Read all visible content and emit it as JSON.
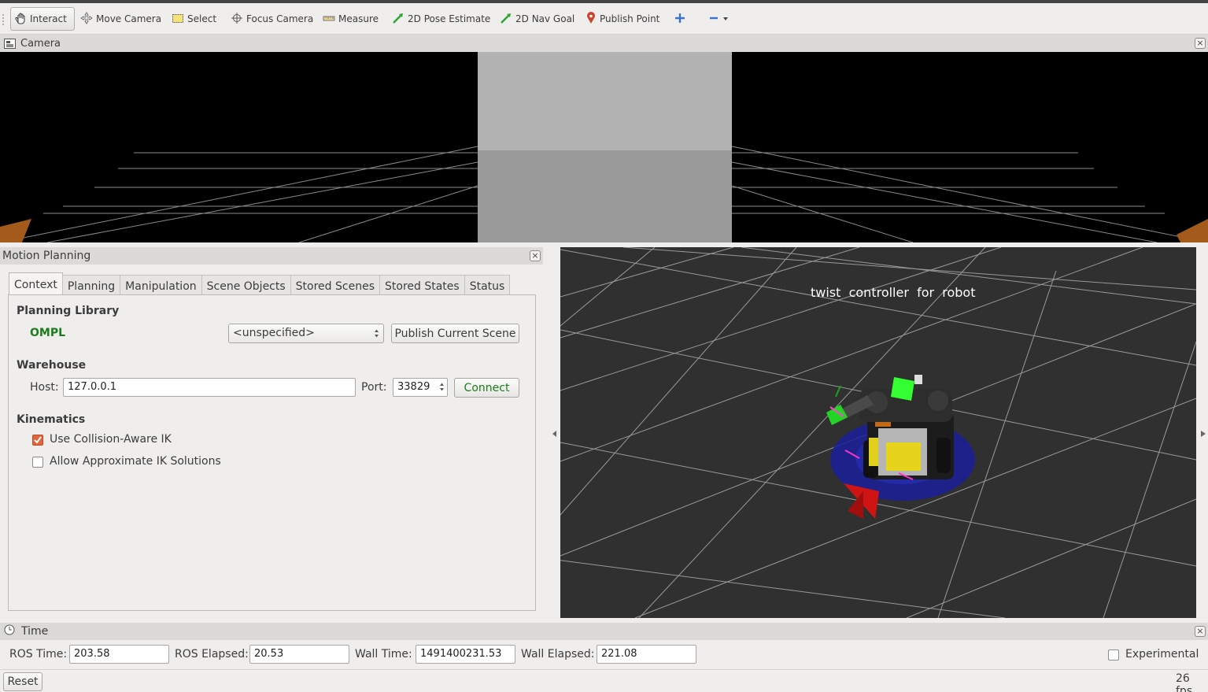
{
  "toolbar": {
    "tools": [
      {
        "label": "Interact",
        "icon": "hand-pointer-icon"
      },
      {
        "label": "Move Camera",
        "icon": "move-arrows-icon"
      },
      {
        "label": "Select",
        "icon": "selection-box-icon"
      },
      {
        "label": "Focus Camera",
        "icon": "crosshair-icon"
      },
      {
        "label": "Measure",
        "icon": "ruler-icon"
      },
      {
        "label": "2D Pose Estimate",
        "icon": "green-arrow-icon"
      },
      {
        "label": "2D Nav Goal",
        "icon": "green-arrow-icon"
      },
      {
        "label": "Publish Point",
        "icon": "map-pin-icon"
      }
    ],
    "add_icon": "plus-icon",
    "remove_icon": "minus-icon"
  },
  "camera_panel": {
    "title": "Camera"
  },
  "motion_planning": {
    "title": "Motion Planning",
    "tabs": [
      "Context",
      "Planning",
      "Manipulation",
      "Scene Objects",
      "Stored Scenes",
      "Stored States",
      "Status"
    ],
    "active_tab": "Context",
    "planning_library": {
      "heading": "Planning Library",
      "name": "OMPL",
      "planner_value": "<unspecified>",
      "publish_button": "Publish Current Scene"
    },
    "warehouse": {
      "heading": "Warehouse",
      "host_label": "Host:",
      "host_value": "127.0.0.1",
      "port_label": "Port:",
      "port_value": "33829",
      "connect_button": "Connect"
    },
    "kinematics": {
      "heading": "Kinematics",
      "collision_aware_label": "Use Collision-Aware IK",
      "collision_aware_checked": true,
      "approx_label": "Allow Approximate IK Solutions",
      "approx_checked": false
    }
  },
  "viewport": {
    "overlay_text": "twist  controller  for  robot"
  },
  "time_panel": {
    "title": "Time",
    "ros_time_label": "ROS Time:",
    "ros_time": "203.58",
    "ros_elapsed_label": "ROS Elapsed:",
    "ros_elapsed": "20.53",
    "wall_time_label": "Wall Time:",
    "wall_time": "1491400231.53",
    "wall_elapsed_label": "Wall Elapsed:",
    "wall_elapsed": "221.08",
    "experimental_label": "Experimental",
    "experimental_checked": false
  },
  "statusbar": {
    "reset_button": "Reset",
    "fps": "26 fps"
  },
  "colors": {
    "accent_green": "#1a7d1a",
    "checkbox_orange": "#e2643a",
    "viewport_bg": "#303030"
  }
}
